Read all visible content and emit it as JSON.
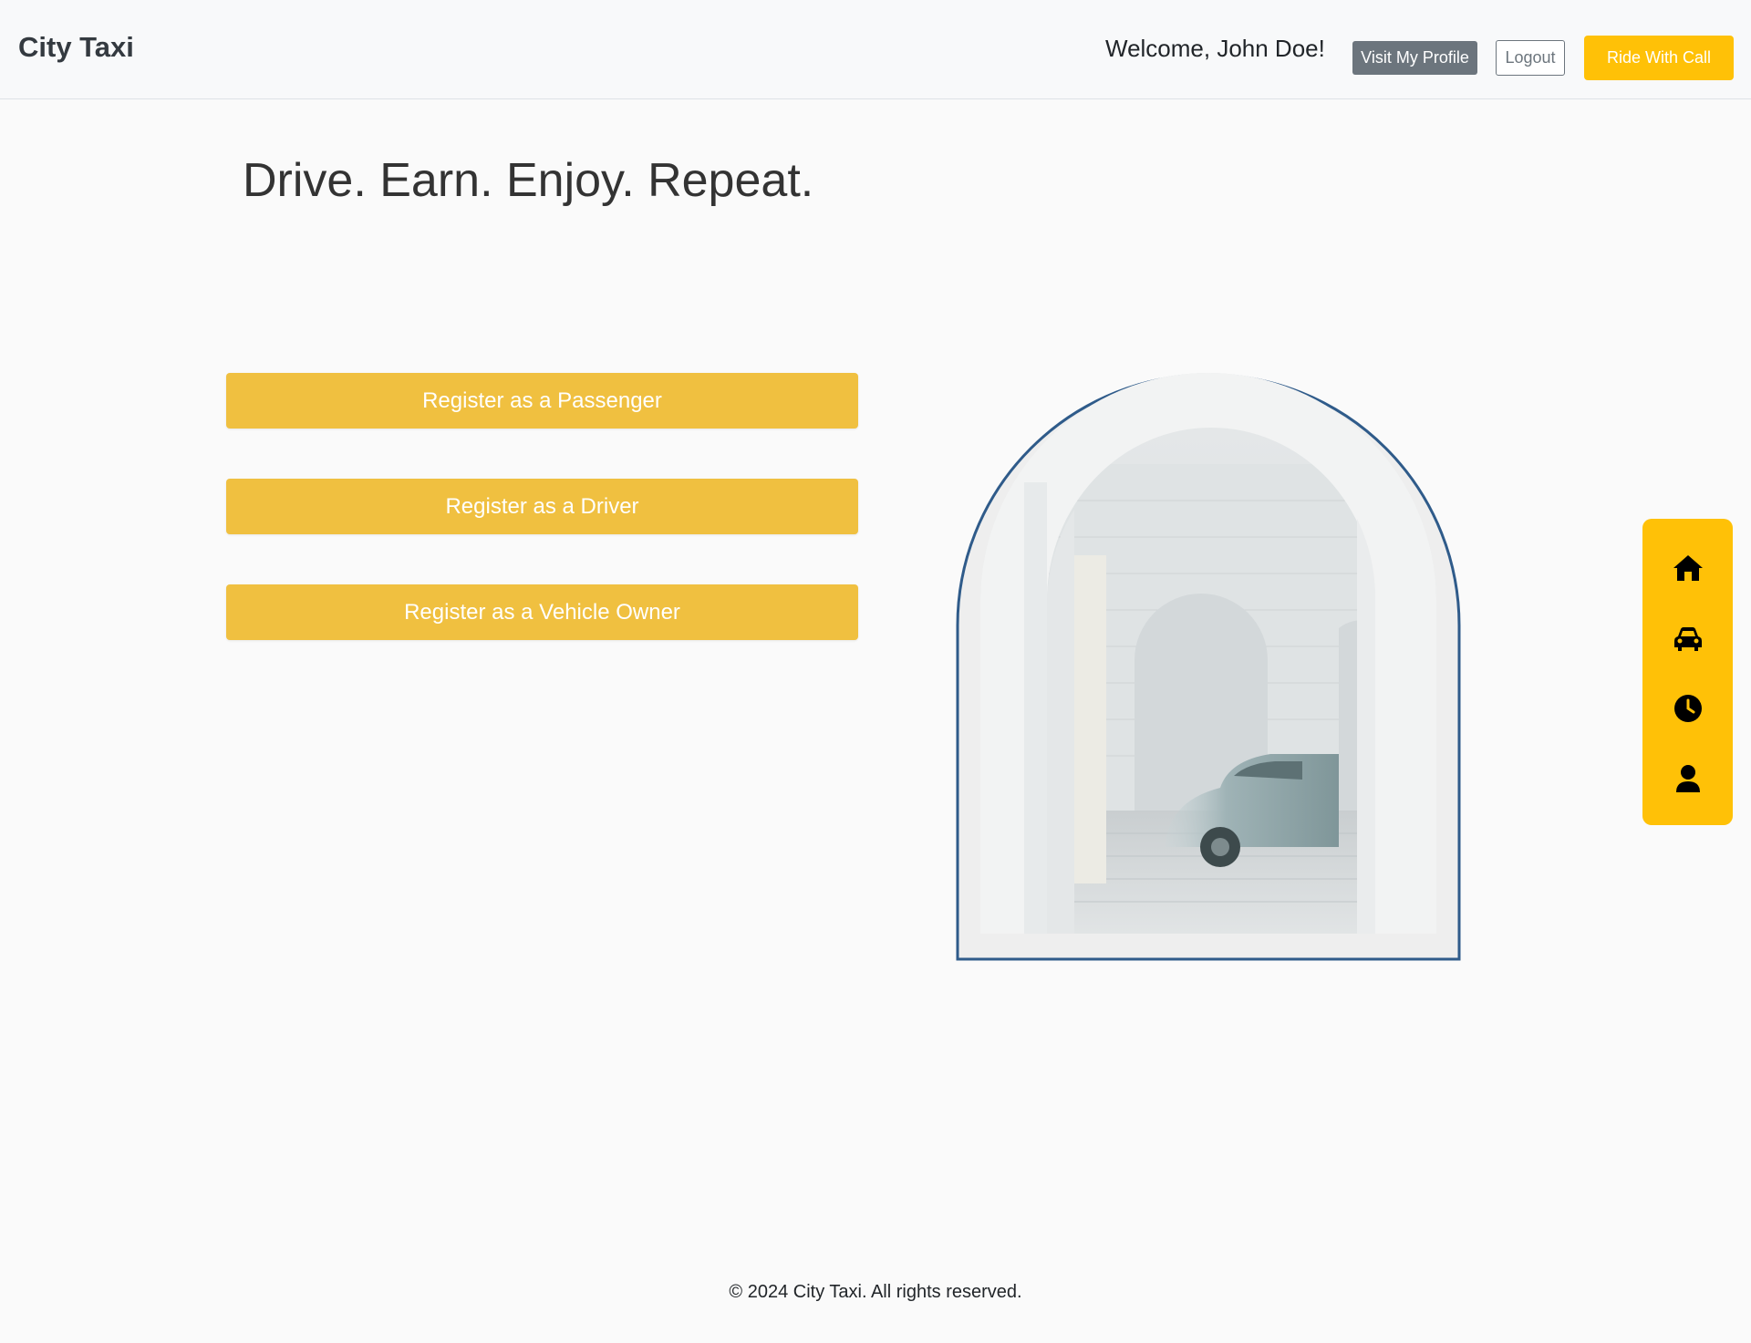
{
  "navbar": {
    "brand": "City Taxi",
    "welcome": "Welcome, John Doe!",
    "profile_button": "Visit My Profile",
    "logout_button": "Logout",
    "call_button": "Ride With Call"
  },
  "hero": {
    "title": "Drive. Earn. Enjoy. Repeat."
  },
  "register_buttons": [
    {
      "label": "Register as a Passenger"
    },
    {
      "label": "Register as a Driver"
    },
    {
      "label": "Register as a Vehicle Owner"
    }
  ],
  "sidebar": {
    "items": [
      {
        "icon": "home-icon"
      },
      {
        "icon": "car-icon"
      },
      {
        "icon": "clock-icon"
      },
      {
        "icon": "user-icon"
      }
    ]
  },
  "footer": {
    "text": "© 2024 City Taxi. All rights reserved."
  },
  "colors": {
    "accent": "#ffc107",
    "register_button": "#f0c040",
    "profile_button": "#6c757d",
    "arch_border": "#2f5b8a"
  }
}
